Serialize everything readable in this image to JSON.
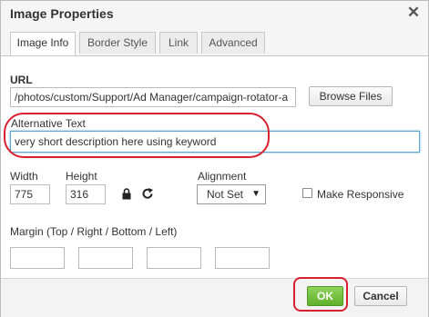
{
  "dialog": {
    "title": "Image Properties"
  },
  "tabs": [
    {
      "label": "Image Info"
    },
    {
      "label": "Border Style"
    },
    {
      "label": "Link"
    },
    {
      "label": "Advanced"
    }
  ],
  "url": {
    "label": "URL",
    "value": "/photos/custom/Support/Ad Manager/campaign-rotator-a",
    "browse_label": "Browse Files"
  },
  "alt": {
    "label": "Alternative Text",
    "value": "very short description here using keyword"
  },
  "size": {
    "width_label": "Width",
    "width_value": "775",
    "height_label": "Height",
    "height_value": "316"
  },
  "alignment": {
    "label": "Alignment",
    "value": "Not Set"
  },
  "responsive": {
    "label": "Make Responsive",
    "checked": false
  },
  "margin": {
    "label": "Margin (Top / Right / Bottom / Left)",
    "values": [
      "",
      "",
      "",
      ""
    ]
  },
  "footer": {
    "ok_label": "OK",
    "cancel_label": "Cancel"
  },
  "colors": {
    "ok_green": "#6cc133",
    "annotation_red": "#d9202f"
  }
}
